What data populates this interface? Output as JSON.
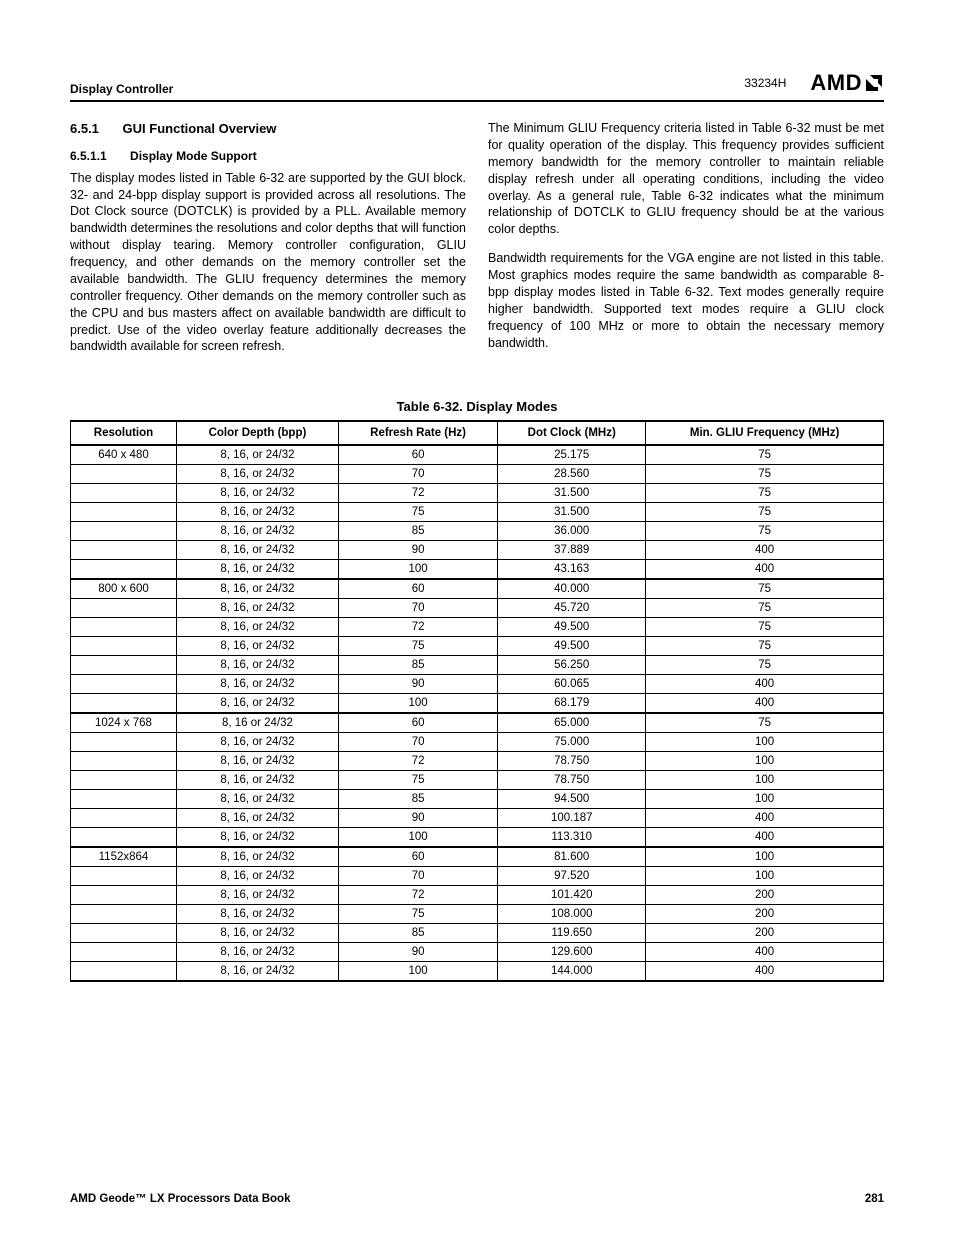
{
  "header": {
    "section": "Display Controller",
    "code": "33234H",
    "logo_text": "AMD"
  },
  "section": {
    "number": "6.5.1",
    "title": "GUI Functional Overview"
  },
  "subsection": {
    "number": "6.5.1.1",
    "title": "Display Mode Support"
  },
  "paragraphs": {
    "left1": "The display modes listed in Table 6-32 are supported by the GUI block. 32- and 24-bpp display support is provided across all resolutions. The Dot Clock source (DOTCLK) is provided by a PLL. Available memory bandwidth determines the resolutions and color depths that will function without display tearing. Memory controller configuration, GLIU frequency, and other demands on the memory controller set the available bandwidth. The GLIU frequency determines the memory controller frequency. Other demands on the memory controller such as the CPU and bus masters affect on available bandwidth are difficult to predict. Use of the video overlay feature additionally decreases the bandwidth available for screen refresh.",
    "right1": "The Minimum GLIU Frequency criteria listed in Table 6-32 must be met for quality operation of the display. This frequency provides sufficient memory bandwidth for the memory controller to maintain reliable display refresh under all operating conditions, including the video overlay. As a general rule, Table 6-32 indicates what the minimum relationship of DOTCLK to GLIU frequency should be at the various color depths.",
    "right2": "Bandwidth requirements for the VGA engine are not listed in this table. Most graphics modes require the same bandwidth as comparable 8-bpp display modes listed in Table 6-32. Text modes generally require higher bandwidth. Supported text modes require a GLIU clock frequency of 100 MHz or more to obtain the necessary memory bandwidth."
  },
  "table": {
    "caption": "Table 6-32.  Display Modes",
    "headers": [
      "Resolution",
      "Color Depth (bpp)",
      "Refresh Rate (Hz)",
      "Dot Clock (MHz)",
      "Min. GLIU Frequency (MHz)"
    ]
  },
  "chart_data": {
    "type": "table",
    "groups": [
      {
        "resolution": "640 x 480",
        "rows": [
          {
            "depth": "8, 16, or 24/32",
            "refresh": "60",
            "dotclock": "25.175",
            "gliu": "75"
          },
          {
            "depth": "8, 16, or 24/32",
            "refresh": "70",
            "dotclock": "28.560",
            "gliu": "75"
          },
          {
            "depth": "8, 16, or 24/32",
            "refresh": "72",
            "dotclock": "31.500",
            "gliu": "75"
          },
          {
            "depth": "8, 16, or 24/32",
            "refresh": "75",
            "dotclock": "31.500",
            "gliu": "75"
          },
          {
            "depth": "8, 16, or 24/32",
            "refresh": "85",
            "dotclock": "36.000",
            "gliu": "75"
          },
          {
            "depth": "8, 16, or 24/32",
            "refresh": "90",
            "dotclock": "37.889",
            "gliu": "400"
          },
          {
            "depth": "8, 16, or 24/32",
            "refresh": "100",
            "dotclock": "43.163",
            "gliu": "400"
          }
        ]
      },
      {
        "resolution": "800 x 600",
        "rows": [
          {
            "depth": "8, 16, or 24/32",
            "refresh": "60",
            "dotclock": "40.000",
            "gliu": "75"
          },
          {
            "depth": "8, 16, or 24/32",
            "refresh": "70",
            "dotclock": "45.720",
            "gliu": "75"
          },
          {
            "depth": "8, 16, or 24/32",
            "refresh": "72",
            "dotclock": "49.500",
            "gliu": "75"
          },
          {
            "depth": "8, 16, or 24/32",
            "refresh": "75",
            "dotclock": "49.500",
            "gliu": "75"
          },
          {
            "depth": "8, 16, or 24/32",
            "refresh": "85",
            "dotclock": "56.250",
            "gliu": "75"
          },
          {
            "depth": "8, 16, or 24/32",
            "refresh": "90",
            "dotclock": "60.065",
            "gliu": "400"
          },
          {
            "depth": "8, 16, or 24/32",
            "refresh": "100",
            "dotclock": "68.179",
            "gliu": "400"
          }
        ]
      },
      {
        "resolution": "1024 x 768",
        "rows": [
          {
            "depth": "8, 16 or 24/32",
            "refresh": "60",
            "dotclock": "65.000",
            "gliu": "75"
          },
          {
            "depth": "8, 16, or 24/32",
            "refresh": "70",
            "dotclock": "75.000",
            "gliu": "100"
          },
          {
            "depth": "8, 16, or 24/32",
            "refresh": "72",
            "dotclock": "78.750",
            "gliu": "100"
          },
          {
            "depth": "8, 16, or 24/32",
            "refresh": "75",
            "dotclock": "78.750",
            "gliu": "100"
          },
          {
            "depth": "8, 16, or 24/32",
            "refresh": "85",
            "dotclock": "94.500",
            "gliu": "100"
          },
          {
            "depth": "8, 16, or 24/32",
            "refresh": "90",
            "dotclock": "100.187",
            "gliu": "400"
          },
          {
            "depth": "8, 16, or 24/32",
            "refresh": "100",
            "dotclock": "113.310",
            "gliu": "400"
          }
        ]
      },
      {
        "resolution": "1152x864",
        "rows": [
          {
            "depth": "8, 16, or 24/32",
            "refresh": "60",
            "dotclock": "81.600",
            "gliu": "100"
          },
          {
            "depth": "8, 16, or 24/32",
            "refresh": "70",
            "dotclock": "97.520",
            "gliu": "100"
          },
          {
            "depth": "8, 16, or 24/32",
            "refresh": "72",
            "dotclock": "101.420",
            "gliu": "200"
          },
          {
            "depth": "8, 16, or 24/32",
            "refresh": "75",
            "dotclock": "108.000",
            "gliu": "200"
          },
          {
            "depth": "8, 16, or 24/32",
            "refresh": "85",
            "dotclock": "119.650",
            "gliu": "200"
          },
          {
            "depth": "8, 16, or 24/32",
            "refresh": "90",
            "dotclock": "129.600",
            "gliu": "400"
          },
          {
            "depth": "8, 16, or 24/32",
            "refresh": "100",
            "dotclock": "144.000",
            "gliu": "400"
          }
        ]
      }
    ]
  },
  "footer": {
    "left": "AMD Geode™ LX Processors Data Book",
    "right": "281"
  }
}
